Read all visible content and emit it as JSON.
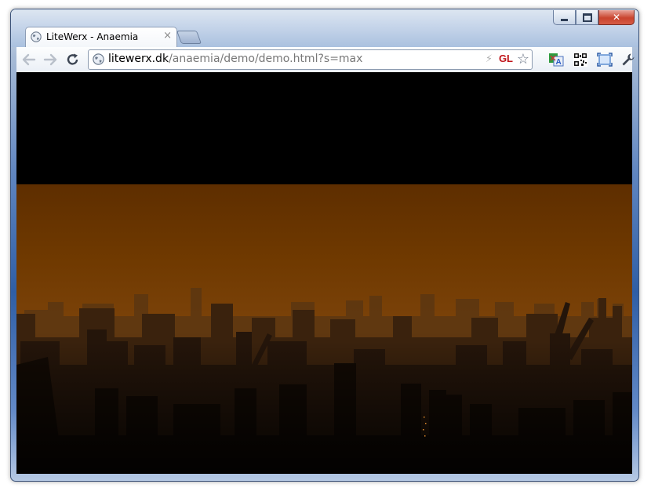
{
  "browser": {
    "tab_title": "LiteWerx - Anaemia",
    "tab_close": "×",
    "url_domain": "litewerx.dk",
    "url_path": "/anaemia/demo/demo.html?s=max",
    "extension_gl": "GL",
    "icons": {
      "back": "back-arrow-icon",
      "forward": "forward-arrow-icon",
      "reload": "reload-icon",
      "page": "globe-icon",
      "instant": "lightning-icon",
      "bookmark": "star-icon",
      "translate": "translate-icon",
      "qr": "qr-code-icon",
      "fullscreen": "fullscreen-icon",
      "settings": "wrench-icon"
    }
  },
  "window_controls": {
    "close_glyph": "✕"
  },
  "colors": {
    "sky_top": "#6b3500",
    "sky_horizon": "#8a4a0c",
    "ground": "#0a0603",
    "letterbox": "#000000"
  }
}
